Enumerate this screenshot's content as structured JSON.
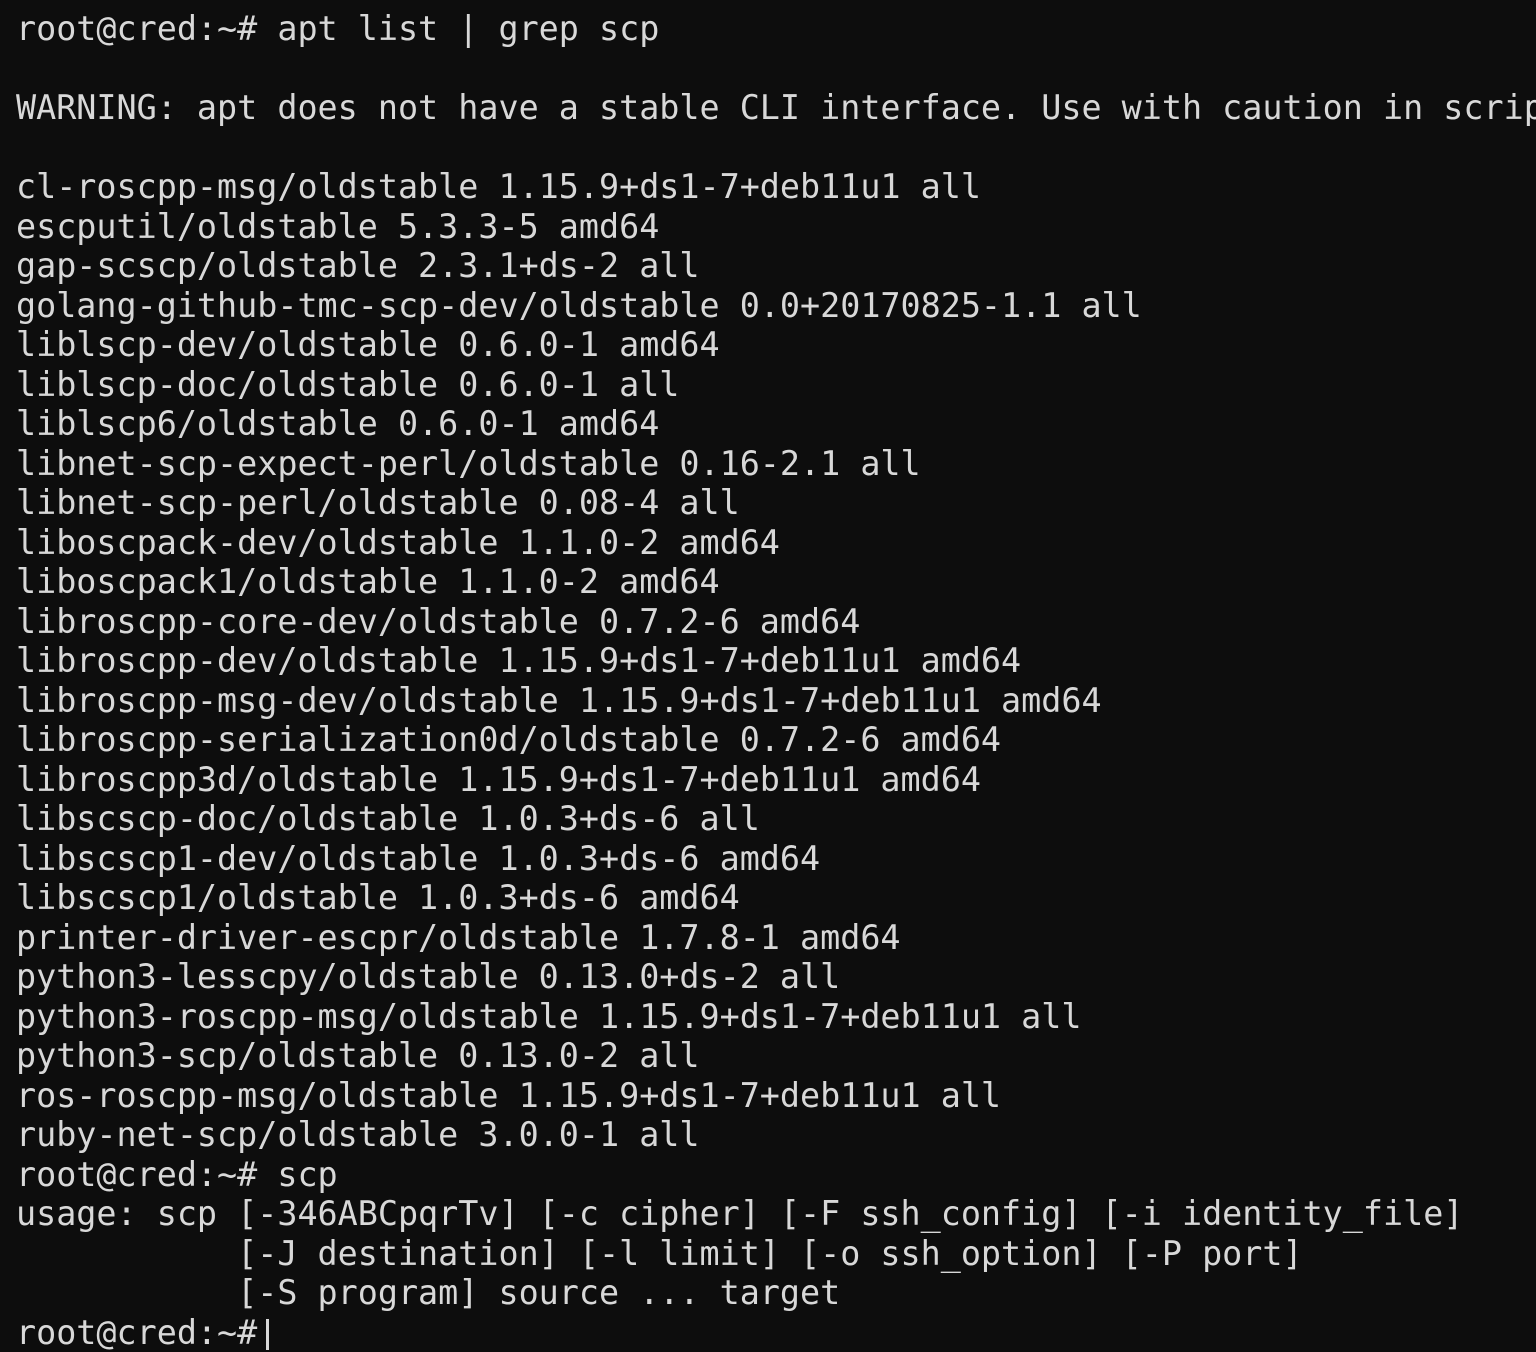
{
  "terminal": {
    "colors": {
      "background": "#0d0d0d",
      "foreground": "#d8d8d8",
      "cursor": "#d8d8d8"
    },
    "prompt": "root@cred:~#",
    "lines": [
      {
        "id": "cmd-apt-list",
        "type": "prompt",
        "text": "root@cred:~# apt list | grep scp"
      },
      {
        "id": "blank-1",
        "type": "blank",
        "text": ""
      },
      {
        "id": "warning",
        "type": "output",
        "text": "WARNING: apt does not have a stable CLI interface. Use with caution in scripts."
      },
      {
        "id": "blank-2",
        "type": "blank",
        "text": ""
      },
      {
        "id": "pkg-cl-roscpp-msg",
        "type": "output",
        "text": "cl-roscpp-msg/oldstable 1.15.9+ds1-7+deb11u1 all"
      },
      {
        "id": "pkg-escputil",
        "type": "output",
        "text": "escputil/oldstable 5.3.3-5 amd64"
      },
      {
        "id": "pkg-gap-scscp",
        "type": "output",
        "text": "gap-scscp/oldstable 2.3.1+ds-2 all"
      },
      {
        "id": "pkg-golang-github-tmc-scp-dev",
        "type": "output",
        "text": "golang-github-tmc-scp-dev/oldstable 0.0+20170825-1.1 all"
      },
      {
        "id": "pkg-liblscp-dev",
        "type": "output",
        "text": "liblscp-dev/oldstable 0.6.0-1 amd64"
      },
      {
        "id": "pkg-liblscp-doc",
        "type": "output",
        "text": "liblscp-doc/oldstable 0.6.0-1 all"
      },
      {
        "id": "pkg-liblscp6",
        "type": "output",
        "text": "liblscp6/oldstable 0.6.0-1 amd64"
      },
      {
        "id": "pkg-libnet-scp-expect-perl",
        "type": "output",
        "text": "libnet-scp-expect-perl/oldstable 0.16-2.1 all"
      },
      {
        "id": "pkg-libnet-scp-perl",
        "type": "output",
        "text": "libnet-scp-perl/oldstable 0.08-4 all"
      },
      {
        "id": "pkg-liboscpack-dev",
        "type": "output",
        "text": "liboscpack-dev/oldstable 1.1.0-2 amd64"
      },
      {
        "id": "pkg-liboscpack1",
        "type": "output",
        "text": "liboscpack1/oldstable 1.1.0-2 amd64"
      },
      {
        "id": "pkg-libroscpp-core-dev",
        "type": "output",
        "text": "libroscpp-core-dev/oldstable 0.7.2-6 amd64"
      },
      {
        "id": "pkg-libroscpp-dev",
        "type": "output",
        "text": "libroscpp-dev/oldstable 1.15.9+ds1-7+deb11u1 amd64"
      },
      {
        "id": "pkg-libroscpp-msg-dev",
        "type": "output",
        "text": "libroscpp-msg-dev/oldstable 1.15.9+ds1-7+deb11u1 amd64"
      },
      {
        "id": "pkg-libroscpp-serialization0d",
        "type": "output",
        "text": "libroscpp-serialization0d/oldstable 0.7.2-6 amd64"
      },
      {
        "id": "pkg-libroscpp3d",
        "type": "output",
        "text": "libroscpp3d/oldstable 1.15.9+ds1-7+deb11u1 amd64"
      },
      {
        "id": "pkg-libscscp-doc",
        "type": "output",
        "text": "libscscp-doc/oldstable 1.0.3+ds-6 all"
      },
      {
        "id": "pkg-libscscp1-dev",
        "type": "output",
        "text": "libscscp1-dev/oldstable 1.0.3+ds-6 amd64"
      },
      {
        "id": "pkg-libscscp1",
        "type": "output",
        "text": "libscscp1/oldstable 1.0.3+ds-6 amd64"
      },
      {
        "id": "pkg-printer-driver-escpr",
        "type": "output",
        "text": "printer-driver-escpr/oldstable 1.7.8-1 amd64"
      },
      {
        "id": "pkg-python3-lesscpy",
        "type": "output",
        "text": "python3-lesscpy/oldstable 0.13.0+ds-2 all"
      },
      {
        "id": "pkg-python3-roscpp-msg",
        "type": "output",
        "text": "python3-roscpp-msg/oldstable 1.15.9+ds1-7+deb11u1 all"
      },
      {
        "id": "pkg-python3-scp",
        "type": "output",
        "text": "python3-scp/oldstable 0.13.0-2 all"
      },
      {
        "id": "pkg-ros-roscpp-msg",
        "type": "output",
        "text": "ros-roscpp-msg/oldstable 1.15.9+ds1-7+deb11u1 all"
      },
      {
        "id": "pkg-ruby-net-scp",
        "type": "output",
        "text": "ruby-net-scp/oldstable 3.0.0-1 all"
      },
      {
        "id": "cmd-scp",
        "type": "prompt",
        "text": "root@cred:~# scp"
      },
      {
        "id": "usage-line-1",
        "type": "output",
        "text": "usage: scp [-346ABCpqrTv] [-c cipher] [-F ssh_config] [-i identity_file]"
      },
      {
        "id": "usage-line-2",
        "type": "output",
        "text": "           [-J destination] [-l limit] [-o ssh_option] [-P port]"
      },
      {
        "id": "usage-line-3",
        "type": "output",
        "text": "           [-S program] source ... target"
      },
      {
        "id": "prompt-final",
        "type": "cursor-prompt",
        "text": "root@cred:~#"
      }
    ]
  }
}
